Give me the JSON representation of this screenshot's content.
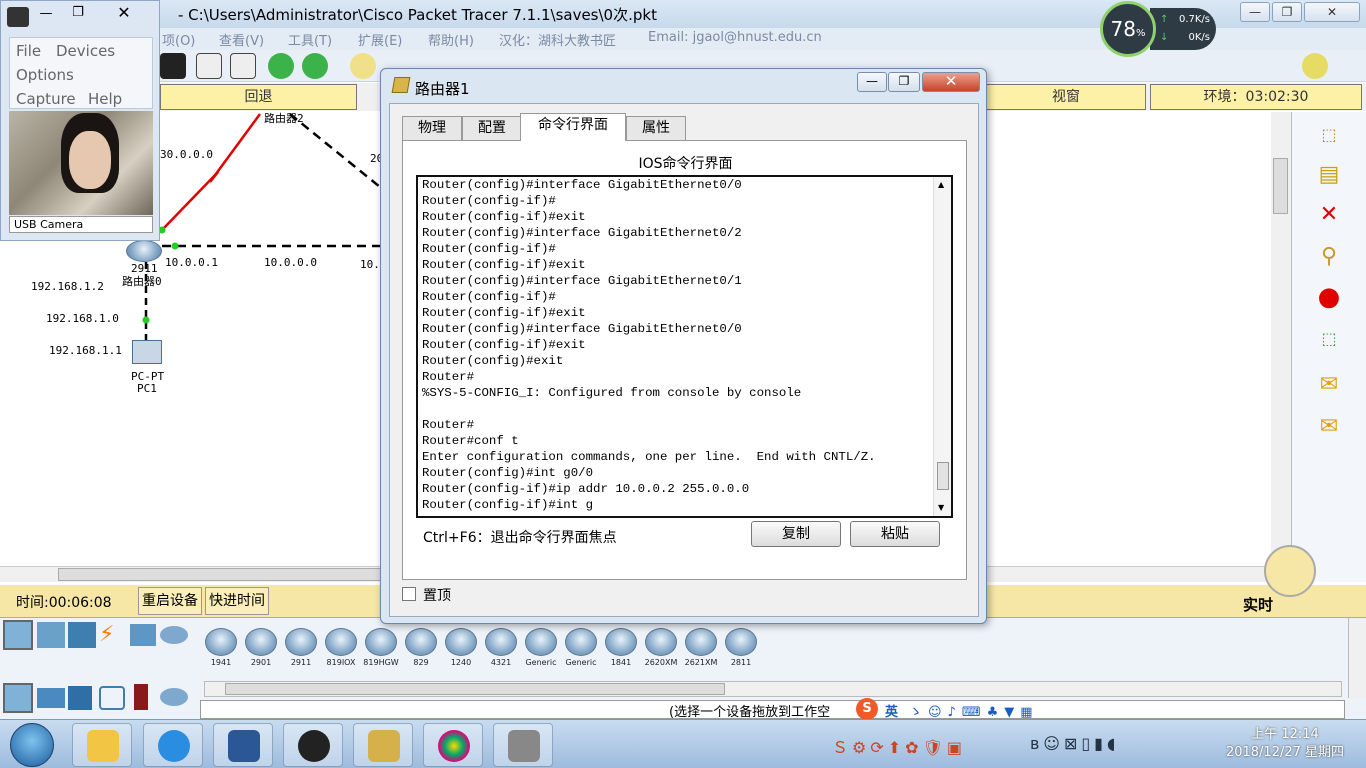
{
  "app": {
    "title": "- C:\\Users\\Administrator\\Cisco Packet Tracer 7.1.1\\saves\\0次.pkt",
    "menu": [
      "项(O)",
      "查看(V)",
      "工具(T)",
      "扩展(E)",
      "帮助(H)",
      "汉化：湖科大教书匠",
      "Email: jgaol@hnust.edu.cn"
    ],
    "mode_bar": {
      "back": "回退",
      "view": "视窗",
      "env": "环境：03:02:30"
    }
  },
  "camera": {
    "menu": [
      "File",
      "Devices",
      "Options",
      "Capture",
      "Help"
    ],
    "label": "USB Camera"
  },
  "net_widget": {
    "percent": "78",
    "unit": "%",
    "up": "0.7K/s",
    "down": "0K/s"
  },
  "topology": {
    "labels": {
      "router2": "路由器2",
      "net30": "30.0.0.0",
      "net20": "20",
      "r0_model": "2911",
      "r0_name": "路由器0",
      "ip10_1": "10.0.0.1",
      "net10": "10.0.0.0",
      "ip10_partial": "10.",
      "ip192_2": "192.168.1.2",
      "net192": "192.168.1.0",
      "ip192_1": "192.168.1.1",
      "pc_model": "PC-PT",
      "pc_name": "PC1"
    }
  },
  "dialog": {
    "title": "路由器1",
    "close": "✕",
    "tabs": [
      "物理",
      "配置",
      "命令行界面",
      "属性"
    ],
    "active_tab": "命令行界面",
    "heading": "IOS命令行界面",
    "terminal": [
      "Router(config)#interface GigabitEthernet0/0",
      "Router(config-if)#",
      "Router(config-if)#exit",
      "Router(config)#interface GigabitEthernet0/2",
      "Router(config-if)#",
      "Router(config-if)#exit",
      "Router(config)#interface GigabitEthernet0/1",
      "Router(config-if)#",
      "Router(config-if)#exit",
      "Router(config)#interface GigabitEthernet0/0",
      "Router(config-if)#exit",
      "Router(config)#exit",
      "Router#",
      "%SYS-5-CONFIG_I: Configured from console by console",
      "",
      "Router#",
      "Router#conf t",
      "Enter configuration commands, one per line.  End with CNTL/Z.",
      "Router(config)#int g0/0",
      "Router(config-if)#ip addr 10.0.0.2 255.0.0.0",
      "Router(config-if)#int g"
    ],
    "hint": "Ctrl+F6：退出命令行界面焦点",
    "copy": "复制",
    "paste": "粘贴",
    "pin": "置顶"
  },
  "status": {
    "time": "时间:00:06:08",
    "restart": "重启设备",
    "fast": "快进时间",
    "realtime": "实时"
  },
  "devices": [
    "1941",
    "2901",
    "2911",
    "819IOX",
    "819HGW",
    "829",
    "1240",
    "4321",
    "Generic",
    "Generic",
    "1841",
    "2620XM",
    "2621XM",
    "2811"
  ],
  "hint_bar": "(选择一个设备拖放到工作空",
  "ime": "英",
  "clock": {
    "time": "上午 12:14",
    "date": "2018/12/27 星期四"
  },
  "colors": {
    "mode_bar": "#fdf1a8",
    "status": "#f7e7a6",
    "link_red": "#e00000"
  }
}
